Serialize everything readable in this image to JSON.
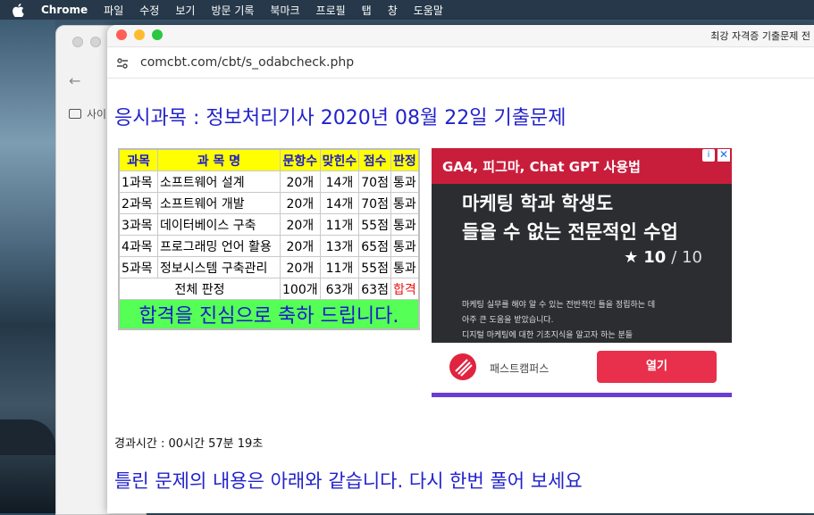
{
  "menubar": {
    "app": "Chrome",
    "items": [
      "파일",
      "수정",
      "보기",
      "방문 기록",
      "북마크",
      "프로필",
      "탭",
      "창",
      "도움말"
    ]
  },
  "back_window": {
    "folder_label": "사이"
  },
  "browser": {
    "tab_title": "최강 자격증 기출문제 전",
    "url": "comcbt.com/cbt/s_odabcheck.php"
  },
  "page": {
    "title": "응시과목 : 정보처리기사 2020년 08월 22일 기출문제",
    "table": {
      "headers": [
        "과목",
        "과 목 명",
        "문항수",
        "맞힌수",
        "점수",
        "판정"
      ],
      "rows": [
        [
          "1과목",
          "소프트웨어 설계",
          "20개",
          "14개",
          "70점",
          "통과"
        ],
        [
          "2과목",
          "소프트웨어 개발",
          "20개",
          "14개",
          "70점",
          "통과"
        ],
        [
          "3과목",
          "데이터베이스 구축",
          "20개",
          "11개",
          "55점",
          "통과"
        ],
        [
          "4과목",
          "프로그래밍 언어 활용",
          "20개",
          "13개",
          "65점",
          "통과"
        ],
        [
          "5과목",
          "정보시스템 구축관리",
          "20개",
          "11개",
          "55점",
          "통과"
        ]
      ],
      "total": {
        "label": "전체 판정",
        "questions": "100개",
        "correct": "63개",
        "score": "63점",
        "result": "합격"
      },
      "congrats": "합격을 진심으로 축하 드립니다."
    },
    "elapsed": "경과시간 : 00시간 57분 19초",
    "retry_message": "틀린 문제의 내용은 아래와 같습니다. 다시 한번 풀어 보세요"
  },
  "ad": {
    "header": "GA4, 피그마, Chat GPT 사용법",
    "headline_1": "마케팅 학과 학생도",
    "headline_2": "들을 수 없는 전문적인 수업",
    "rating": "10",
    "rating_den": "/ 10",
    "desc_1": "마케팅 실무를 해야 알 수 있는 전반적인 틀을 정립하는 데",
    "desc_2": "아주 큰 도움을 받았습니다.",
    "desc_3": "디지털 마케팅에 대한 기초지식을 알고자 하는 분들",
    "brand": "패스트캠퍼스",
    "cta": "열기",
    "accent": "#c81e3c"
  }
}
